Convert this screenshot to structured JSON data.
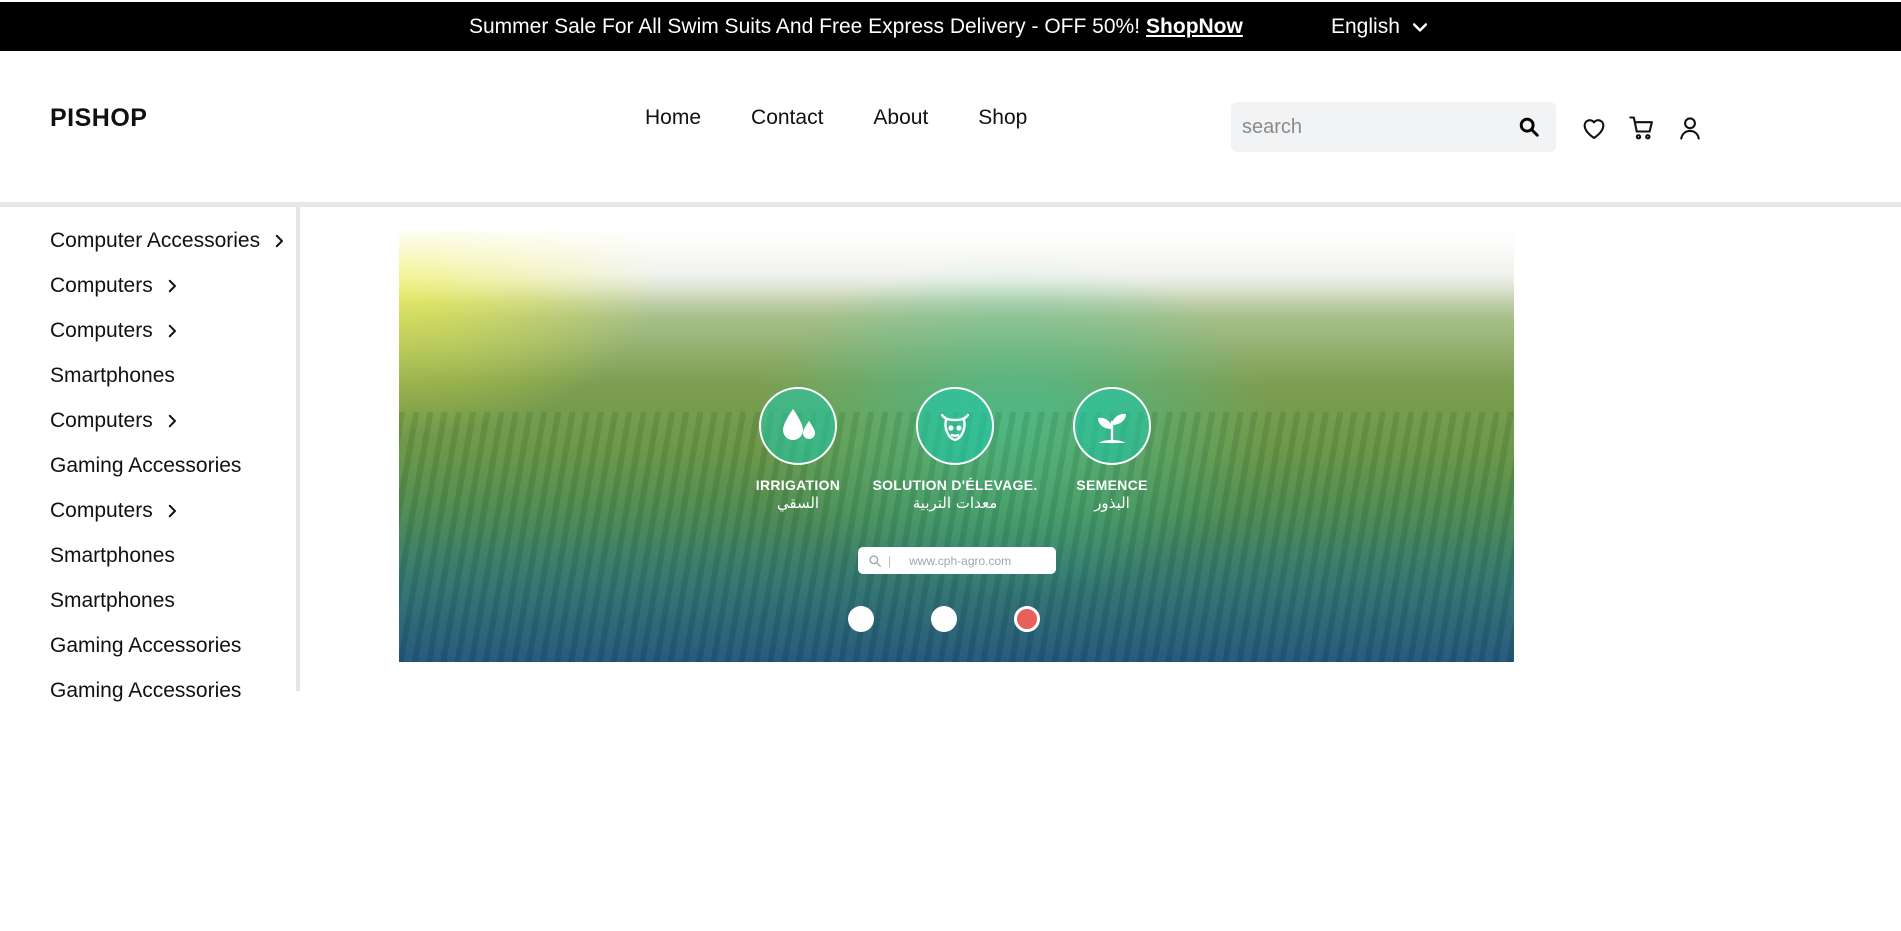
{
  "topbar": {
    "promo_text": "Summer Sale For All Swim Suits And Free Express Delivery - OFF 50%!",
    "promo_link": "ShopNow",
    "language": "English"
  },
  "header": {
    "logo": "PISHOP",
    "nav": [
      "Home",
      "Contact",
      "About",
      "Shop"
    ],
    "search_placeholder": "search",
    "icons": [
      "heart-icon",
      "cart-icon",
      "user-icon"
    ]
  },
  "sidebar": {
    "items": [
      {
        "label": "Computer Accessories",
        "has_submenu": true
      },
      {
        "label": "Computers",
        "has_submenu": true
      },
      {
        "label": "Computers",
        "has_submenu": true
      },
      {
        "label": "Smartphones",
        "has_submenu": false
      },
      {
        "label": "Computers",
        "has_submenu": true
      },
      {
        "label": "Gaming Accessories",
        "has_submenu": false
      },
      {
        "label": "Computers",
        "has_submenu": true
      },
      {
        "label": "Smartphones",
        "has_submenu": false
      },
      {
        "label": "Smartphones",
        "has_submenu": false
      },
      {
        "label": "Gaming Accessories",
        "has_submenu": false
      },
      {
        "label": "Gaming Accessories",
        "has_submenu": false
      }
    ]
  },
  "hero": {
    "services": [
      {
        "title": "IRRIGATION",
        "subtitle": "السقي",
        "icon": "water-drops-icon"
      },
      {
        "title": "SOLUTION D'ÉLEVAGE.",
        "subtitle": "معدات التربية",
        "icon": "livestock-icon"
      },
      {
        "title": "SEMENCE",
        "subtitle": "البذور",
        "icon": "seedling-icon"
      }
    ],
    "url_text": "www.cph-agro.com",
    "slides_count": 3,
    "active_slide": 3
  },
  "colors": {
    "topbar_bg": "#000000",
    "active_dot": "#e7605a",
    "search_bg": "#f2f3f5"
  }
}
